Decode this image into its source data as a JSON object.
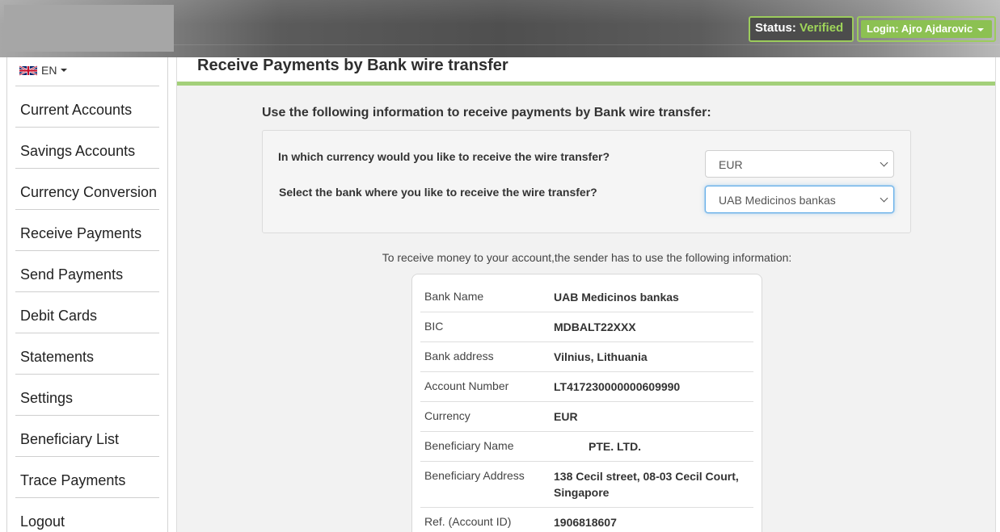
{
  "header": {
    "status_label": "Status:",
    "status_value": "Verified",
    "login_label": "Login: Ajro Ajdarovic"
  },
  "sidebar": {
    "language": "EN",
    "items": [
      {
        "label": "Current Accounts"
      },
      {
        "label": "Savings Accounts"
      },
      {
        "label": "Currency Conversion"
      },
      {
        "label": "Receive Payments"
      },
      {
        "label": "Send Payments"
      },
      {
        "label": "Debit Cards"
      },
      {
        "label": "Statements"
      },
      {
        "label": "Settings"
      },
      {
        "label": "Beneficiary List"
      },
      {
        "label": "Trace Payments"
      },
      {
        "label": "Logout"
      }
    ]
  },
  "main": {
    "title": "Receive Payments by Bank wire transfer",
    "intro": "Use the following information to receive payments by Bank wire transfer:",
    "form": {
      "currency_question": "In which currency would you like to receive the wire transfer?",
      "currency_selected": "EUR",
      "bank_question": "Select the bank where you like to receive the wire transfer?",
      "bank_selected": "UAB Medicinos bankas"
    },
    "sender_note": "To receive money to your account,the sender has to use the following information:",
    "details": [
      {
        "key": "Bank Name",
        "value": "UAB Medicinos bankas"
      },
      {
        "key": "BIC",
        "value": "MDBALT22XXX"
      },
      {
        "key": "Bank address",
        "value": "Vilnius, Lithuania"
      },
      {
        "key": "Account Number",
        "value": "LT417230000000609990"
      },
      {
        "key": "Currency",
        "value": "EUR"
      },
      {
        "key": "Beneficiary Name",
        "value": "PTE. LTD."
      },
      {
        "key": "Beneficiary Address",
        "value": "138 Cecil street, 08-03 Cecil Court,",
        "value2": "Singapore"
      },
      {
        "key": "Ref. (Account ID)",
        "value": "1906818607"
      }
    ]
  },
  "colors": {
    "accent_green": "#8cc152",
    "verified_green": "#9fd55a",
    "title_underline": "#a3d07a",
    "focus_blue": "#66afe9"
  },
  "icons": [
    "uk-flag-icon",
    "caret-down-icon",
    "chevron-down-icon"
  ]
}
